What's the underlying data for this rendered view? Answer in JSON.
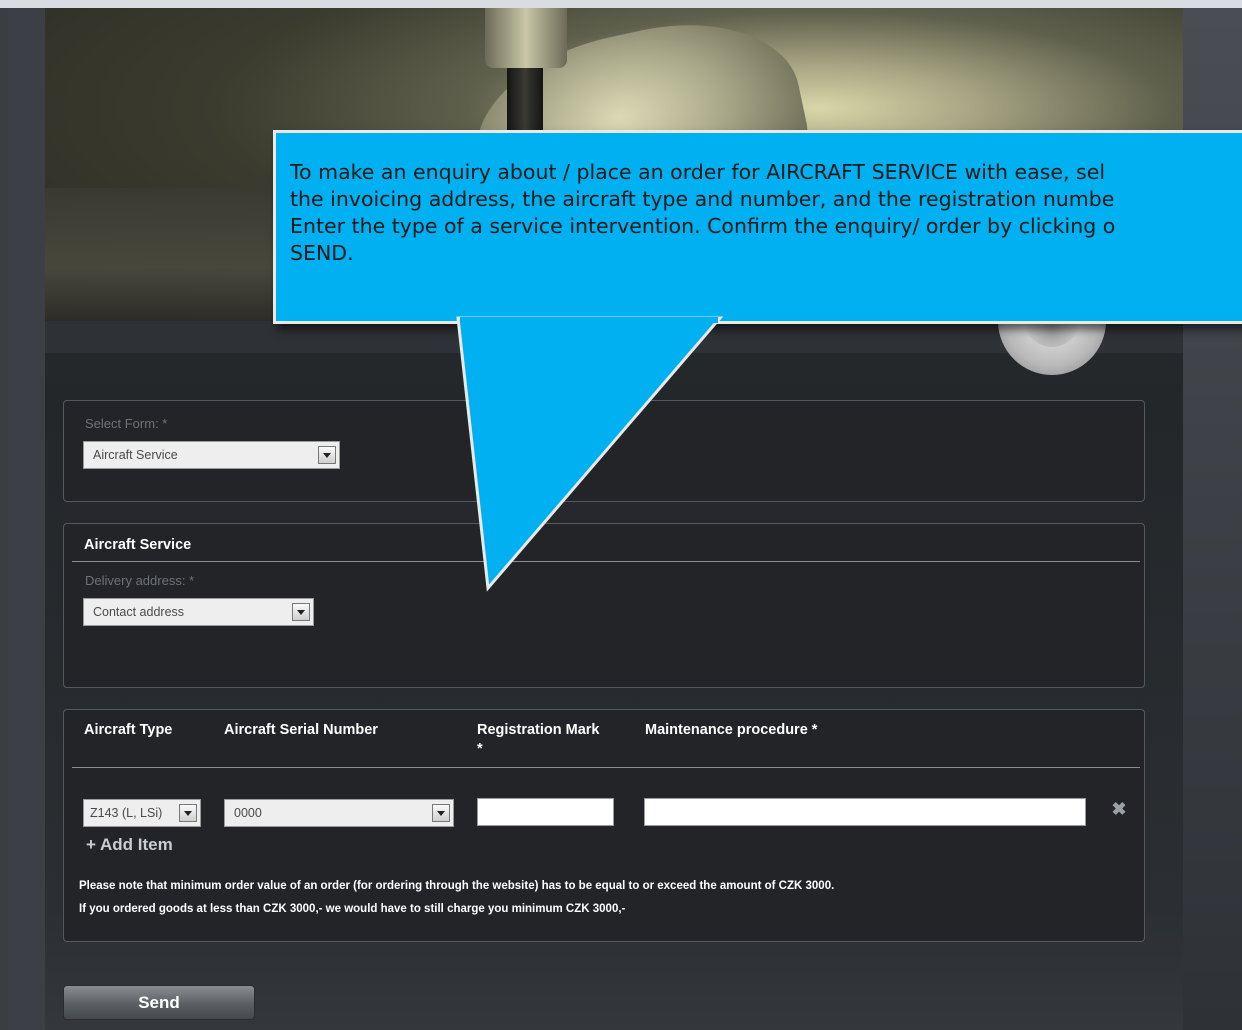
{
  "callout": {
    "lines": [
      "To make an enquiry about / place an order for AIRCRAFT SERVICE with ease, sel",
      "the invoicing address, the aircraft type and number, and the registration numbe",
      "Enter the type of a service intervention. Confirm the enquiry/ order by clicking o",
      "SEND."
    ]
  },
  "select_form": {
    "label": "Select Form: *",
    "value": "Aircraft Service"
  },
  "service": {
    "heading": "Aircraft Service",
    "delivery_label": "Delivery address: *",
    "delivery_value": "Contact address"
  },
  "items": {
    "headers": {
      "type": "Aircraft Type",
      "serial": "Aircraft Serial Number",
      "reg_line1": "Registration Mark",
      "reg_line2": "*",
      "maintenance": "Maintenance procedure *"
    },
    "row": {
      "type_value": "Z143 (L, LSi)",
      "serial_value": "0000",
      "registration_value": "",
      "maintenance_value": ""
    },
    "remove_symbol": "✖",
    "add_item_label": "+ Add Item",
    "notes": [
      "Please note that minimum order value of an order (for ordering through the website) has to be equal to or exceed the amount of CZK 3000.",
      "If you ordered goods at less than CZK 3000,- we would have to still charge you minimum CZK 3000,-"
    ]
  },
  "send_label": "Send",
  "colors": {
    "callout": "#00b0f0",
    "background": "#24272a"
  }
}
